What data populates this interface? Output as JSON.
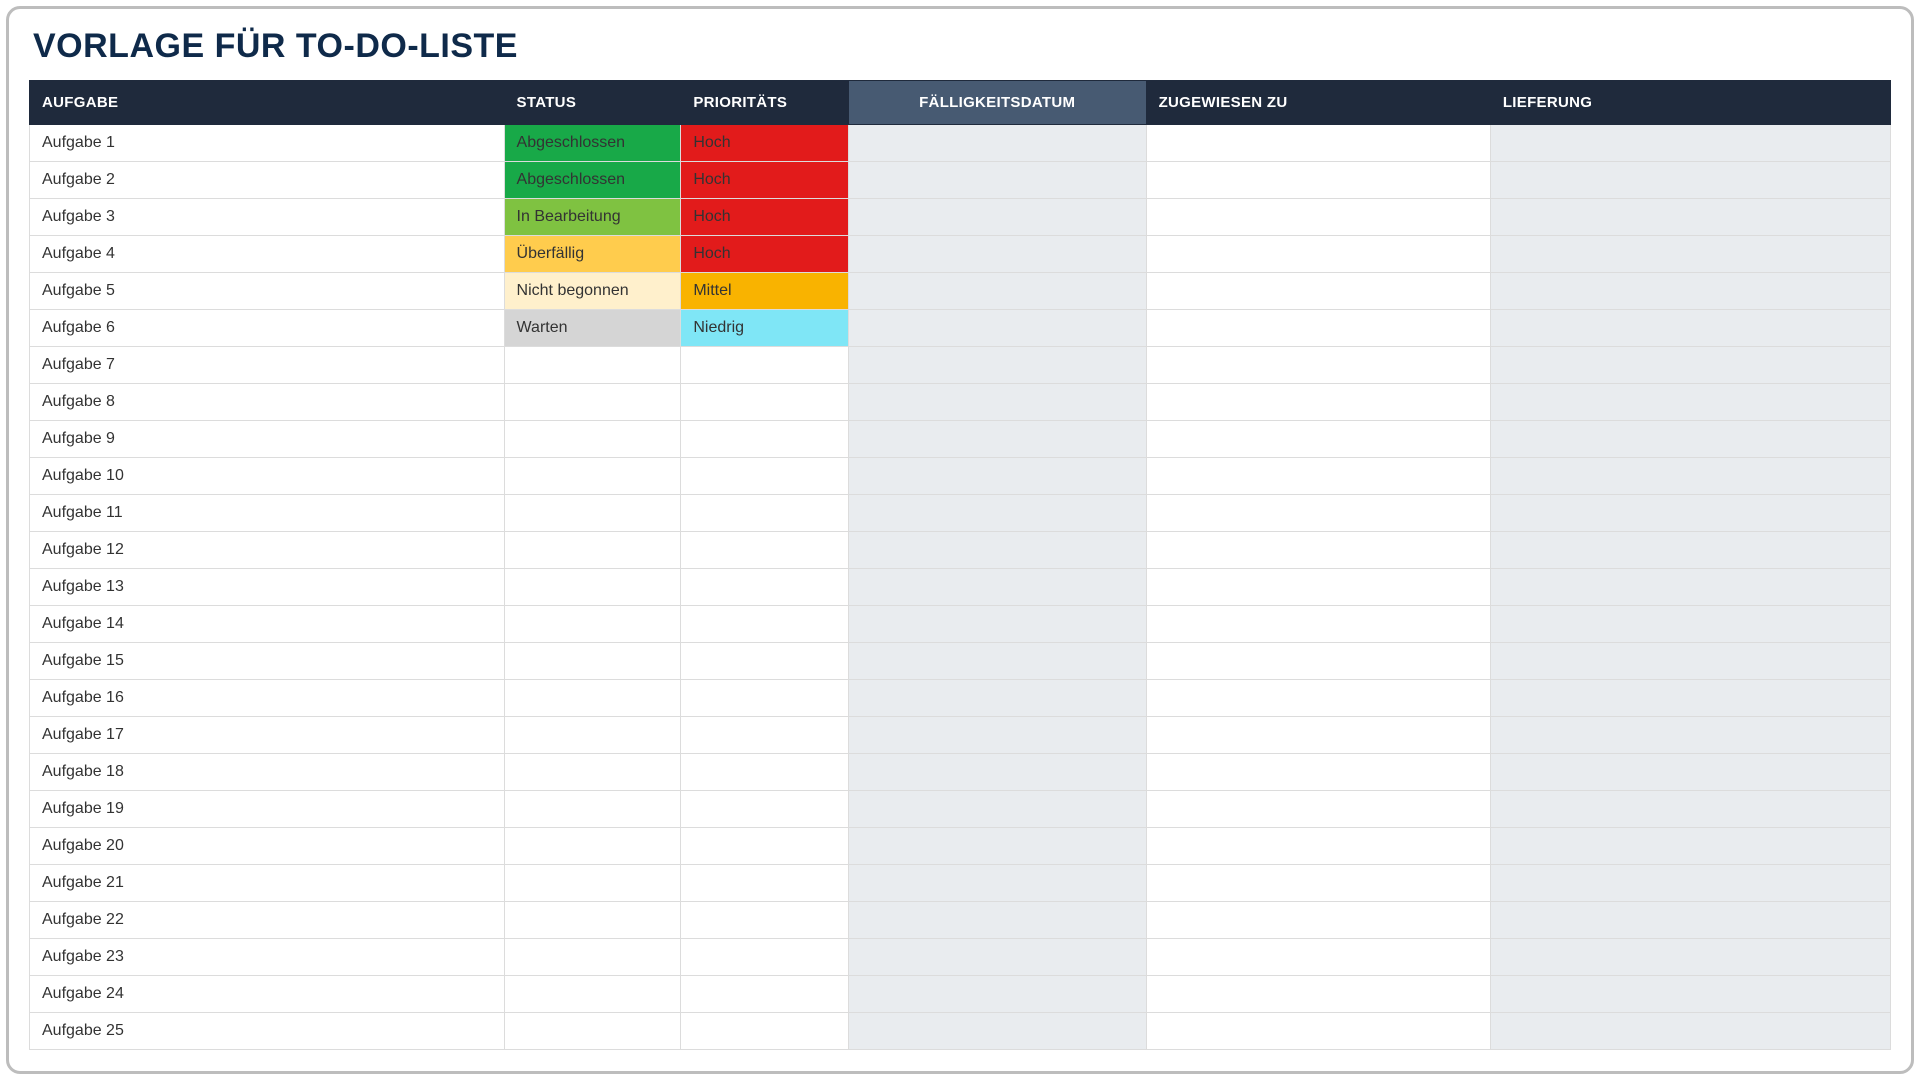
{
  "title": "VORLAGE FÜR TO-DO-LISTE",
  "columns": {
    "aufgabe": "AUFGABE",
    "status": "STATUS",
    "prio": "PRIORITÄTS",
    "faellig": "FÄLLIGKEITSDATUM",
    "zugew": "ZUGEWIESEN ZU",
    "lieferung": "LIEFERUNG"
  },
  "status_colors": {
    "Abgeschlossen": "status-abgeschlossen",
    "In Bearbeitung": "status-inbearbeitung",
    "Überfällig": "status-ueberfaellig",
    "Nicht begonnen": "status-nichtbegonnen",
    "Warten": "status-warten"
  },
  "priority_colors": {
    "Hoch": "prio-hoch",
    "Mittel": "prio-mittel",
    "Niedrig": "prio-niedrig"
  },
  "rows": [
    {
      "aufgabe": "Aufgabe 1",
      "status": "Abgeschlossen",
      "prio": "Hoch",
      "faellig": "",
      "zugew": "",
      "lieferung": ""
    },
    {
      "aufgabe": "Aufgabe 2",
      "status": "Abgeschlossen",
      "prio": "Hoch",
      "faellig": "",
      "zugew": "",
      "lieferung": ""
    },
    {
      "aufgabe": "Aufgabe 3",
      "status": "In Bearbeitung",
      "prio": "Hoch",
      "faellig": "",
      "zugew": "",
      "lieferung": ""
    },
    {
      "aufgabe": "Aufgabe 4",
      "status": "Überfällig",
      "prio": "Hoch",
      "faellig": "",
      "zugew": "",
      "lieferung": ""
    },
    {
      "aufgabe": "Aufgabe 5",
      "status": "Nicht begonnen",
      "prio": "Mittel",
      "faellig": "",
      "zugew": "",
      "lieferung": ""
    },
    {
      "aufgabe": "Aufgabe 6",
      "status": "Warten",
      "prio": "Niedrig",
      "faellig": "",
      "zugew": "",
      "lieferung": ""
    },
    {
      "aufgabe": "Aufgabe 7",
      "status": "",
      "prio": "",
      "faellig": "",
      "zugew": "",
      "lieferung": ""
    },
    {
      "aufgabe": "Aufgabe 8",
      "status": "",
      "prio": "",
      "faellig": "",
      "zugew": "",
      "lieferung": ""
    },
    {
      "aufgabe": "Aufgabe 9",
      "status": "",
      "prio": "",
      "faellig": "",
      "zugew": "",
      "lieferung": ""
    },
    {
      "aufgabe": "Aufgabe 10",
      "status": "",
      "prio": "",
      "faellig": "",
      "zugew": "",
      "lieferung": ""
    },
    {
      "aufgabe": "Aufgabe 11",
      "status": "",
      "prio": "",
      "faellig": "",
      "zugew": "",
      "lieferung": ""
    },
    {
      "aufgabe": "Aufgabe 12",
      "status": "",
      "prio": "",
      "faellig": "",
      "zugew": "",
      "lieferung": ""
    },
    {
      "aufgabe": "Aufgabe 13",
      "status": "",
      "prio": "",
      "faellig": "",
      "zugew": "",
      "lieferung": ""
    },
    {
      "aufgabe": "Aufgabe 14",
      "status": "",
      "prio": "",
      "faellig": "",
      "zugew": "",
      "lieferung": ""
    },
    {
      "aufgabe": "Aufgabe 15",
      "status": "",
      "prio": "",
      "faellig": "",
      "zugew": "",
      "lieferung": ""
    },
    {
      "aufgabe": "Aufgabe 16",
      "status": "",
      "prio": "",
      "faellig": "",
      "zugew": "",
      "lieferung": ""
    },
    {
      "aufgabe": "Aufgabe 17",
      "status": "",
      "prio": "",
      "faellig": "",
      "zugew": "",
      "lieferung": ""
    },
    {
      "aufgabe": "Aufgabe 18",
      "status": "",
      "prio": "",
      "faellig": "",
      "zugew": "",
      "lieferung": ""
    },
    {
      "aufgabe": "Aufgabe 19",
      "status": "",
      "prio": "",
      "faellig": "",
      "zugew": "",
      "lieferung": ""
    },
    {
      "aufgabe": "Aufgabe 20",
      "status": "",
      "prio": "",
      "faellig": "",
      "zugew": "",
      "lieferung": ""
    },
    {
      "aufgabe": "Aufgabe 21",
      "status": "",
      "prio": "",
      "faellig": "",
      "zugew": "",
      "lieferung": ""
    },
    {
      "aufgabe": "Aufgabe 22",
      "status": "",
      "prio": "",
      "faellig": "",
      "zugew": "",
      "lieferung": ""
    },
    {
      "aufgabe": "Aufgabe 23",
      "status": "",
      "prio": "",
      "faellig": "",
      "zugew": "",
      "lieferung": ""
    },
    {
      "aufgabe": "Aufgabe 24",
      "status": "",
      "prio": "",
      "faellig": "",
      "zugew": "",
      "lieferung": ""
    },
    {
      "aufgabe": "Aufgabe 25",
      "status": "",
      "prio": "",
      "faellig": "",
      "zugew": "",
      "lieferung": ""
    }
  ]
}
